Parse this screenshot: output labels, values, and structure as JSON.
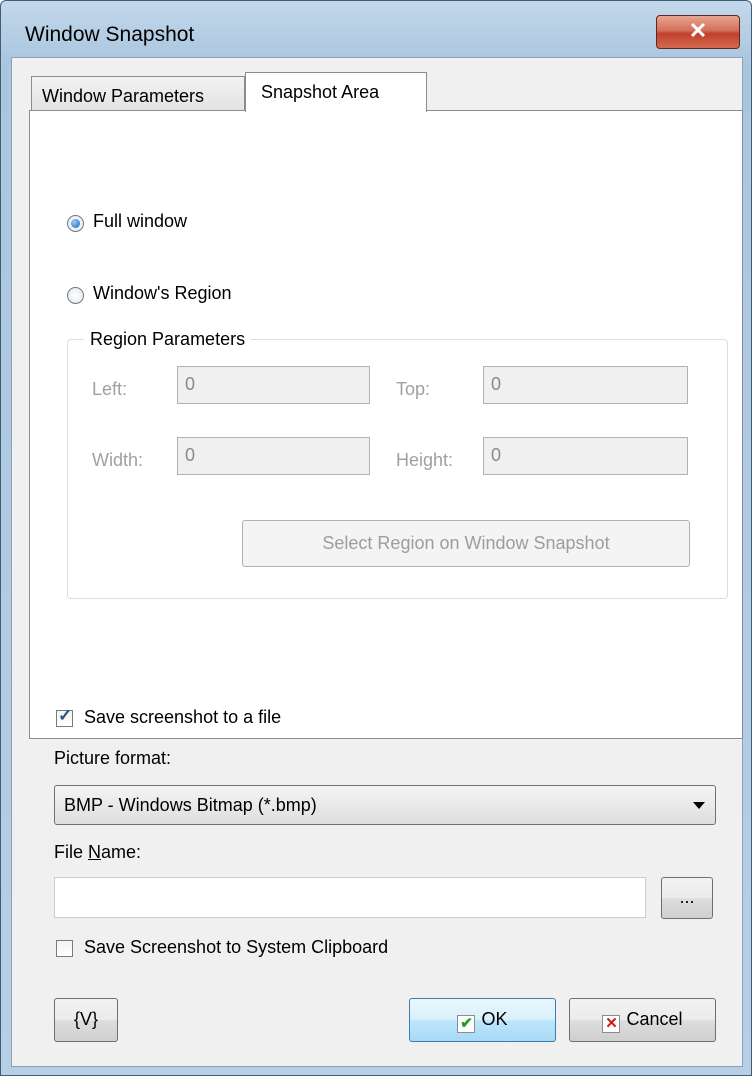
{
  "window": {
    "title": "Window Snapshot",
    "close_glyph": "✕"
  },
  "tabs": [
    {
      "label": "Window Parameters",
      "active": false
    },
    {
      "label": "Snapshot Area",
      "active": true
    }
  ],
  "snapshot_area": {
    "full_window_label": "Full window",
    "region_label": "Window's Region",
    "selected": "Full window",
    "region_group": {
      "title": "Region Parameters",
      "left_label": "Left:",
      "left_value": "0",
      "top_label": "Top:",
      "top_value": "0",
      "width_label": "Width:",
      "width_value": "0",
      "height_label": "Height:",
      "height_value": "0",
      "select_button": "Select Region on Window Snapshot"
    }
  },
  "save": {
    "save_to_file_label": "Save screenshot to a file",
    "save_to_file_checked": true,
    "picture_format_label": "Picture format:",
    "picture_format_value": "BMP - Windows Bitmap (*.bmp)",
    "file_name_label_pre": "File ",
    "file_name_label_accel": "N",
    "file_name_label_post": "ame:",
    "file_name_value": "",
    "browse_label": "...",
    "clipboard_label": "Save Screenshot to System Clipboard",
    "clipboard_checked": false
  },
  "buttons": {
    "variables": "{V}",
    "ok": "OK",
    "cancel": "Cancel",
    "ok_glyph": "✔",
    "cancel_glyph": "✕"
  }
}
